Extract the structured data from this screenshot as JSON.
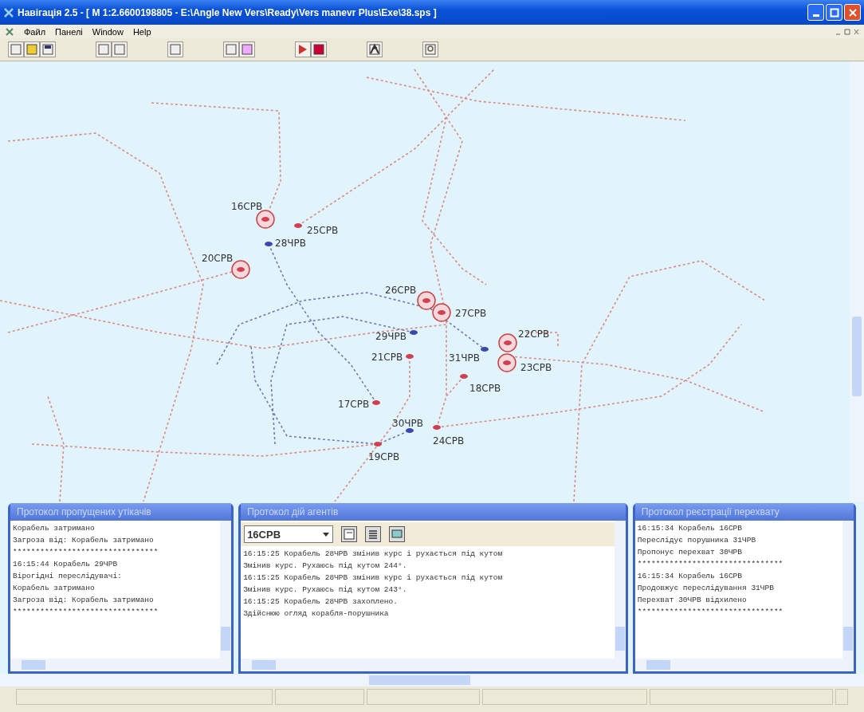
{
  "window": {
    "title": "Навігація 2.5 - [  M 1:2.6600198805 - E:\\Angle New Vers\\Ready\\Vers manevr Plus\\Exe\\38.sps  ]"
  },
  "menu": [
    {
      "label": "Файл"
    },
    {
      "label": "Панелі"
    },
    {
      "label": "Window"
    },
    {
      "label": "Help"
    }
  ],
  "map": {
    "ships": [
      {
        "label": "16СРВ",
        "color": "#d04050",
        "circled": true
      },
      {
        "label": "25СРВ",
        "color": "#d04050",
        "circled": false
      },
      {
        "label": "28ЧРВ",
        "color": "#3848b0",
        "circled": false
      },
      {
        "label": "20СРВ",
        "color": "#d04050",
        "circled": true
      },
      {
        "label": "26СРВ",
        "color": "#d04050",
        "circled": true
      },
      {
        "label": "27СРВ",
        "color": "#d04050",
        "circled": true
      },
      {
        "label": "29ЧРВ",
        "color": "#3848b0",
        "circled": false
      },
      {
        "label": "22СРВ",
        "color": "#d04050",
        "circled": true
      },
      {
        "label": "21СРВ",
        "color": "#d04050",
        "circled": false
      },
      {
        "label": "31ЧРВ",
        "color": "#3848b0",
        "circled": false
      },
      {
        "label": "23СРВ",
        "color": "#d04050",
        "circled": true
      },
      {
        "label": "18СРВ",
        "color": "#d04050",
        "circled": false
      },
      {
        "label": "17СРВ",
        "color": "#d04050",
        "circled": false
      },
      {
        "label": "30ЧРВ",
        "color": "#3848b0",
        "circled": false
      },
      {
        "label": "24СРВ",
        "color": "#d04050",
        "circled": false
      },
      {
        "label": "19СРВ",
        "color": "#d04050",
        "circled": false
      }
    ]
  },
  "panels": [
    {
      "title": "Протокол пропущених утікачів",
      "lines": [
        "Корабель затримано",
        "Загроза від: Корабель затримано",
        "********************************",
        "16:15:44 Корабель 29ЧРВ",
        "Вірогідні переслідувачі:",
        "Корабель затримано",
        "Загроза від: Корабель затримано",
        "********************************"
      ]
    },
    {
      "title": "Протокол дій агентів",
      "selector": {
        "value": "16СРВ"
      },
      "lines": [
        "16:15:25 Корабель 28ЧРВ змінив курс і рухається під кутом",
        "Змінив курс. Рухаюсь під кутом 244°.",
        "16:15:25 Корабель 28ЧРВ змінив курс і рухається під кутом",
        "Змінив курс. Рухаюсь під кутом 243°.",
        "16:15:25 Корабель 28ЧРВ захоплено.",
        "Здійснюю огляд корабля-порушника"
      ]
    },
    {
      "title": "Протокол реєстрації перехвату",
      "lines": [
        "16:15:34 Корабель 16СРВ",
        "Переслідує порушника 31ЧРВ",
        "Пропонує перехват 30ЧРВ",
        "********************************",
        "16:15:34 Корабель 16СРВ",
        "Продовжує переслідування 31ЧРВ",
        "Перехват 30ЧРВ відхилено",
        "********************************"
      ]
    }
  ]
}
